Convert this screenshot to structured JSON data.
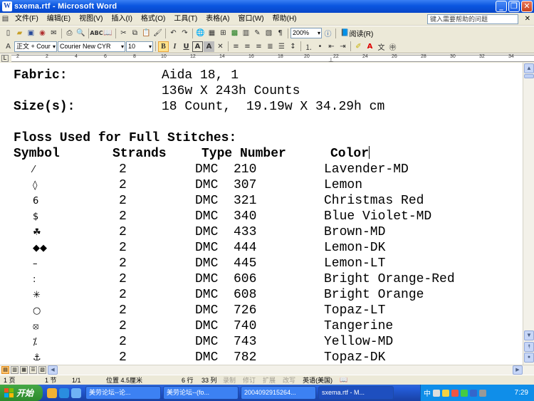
{
  "window": {
    "title": "sxema.rtf - Microsoft Word",
    "app_icon_letter": "W"
  },
  "menu": {
    "items": [
      "文件(F)",
      "编辑(E)",
      "视图(V)",
      "插入(I)",
      "格式(O)",
      "工具(T)",
      "表格(A)",
      "窗口(W)",
      "帮助(H)"
    ],
    "help_placeholder": "键入需要帮助的问题"
  },
  "toolbar": {
    "zoom": "200%",
    "reading_label": "阅读(R)",
    "style": "正文 + Cour",
    "font": "Courier New CYR",
    "size": "10",
    "bold": "B",
    "italic": "I",
    "underline": "U"
  },
  "ruler": {
    "numbers": [
      "2",
      "2",
      "4",
      "6",
      "8",
      "10",
      "12",
      "14",
      "16",
      "18",
      "20",
      "22",
      "24",
      "26",
      "28",
      "30",
      "32",
      "34"
    ]
  },
  "document": {
    "fabric_label": "Fabric:",
    "fabric_value": "Aida 18, 1",
    "counts": "136w X 243h Counts",
    "size_label": "Size(s):",
    "size_value": "18 Count,  19.19w X 34.29h cm",
    "floss_heading": "Floss Used for Full Stitches:",
    "headers": {
      "symbol": "Symbol",
      "strands": "Strands",
      "type_number": "Type Number",
      "color": "Color"
    },
    "rows": [
      {
        "symbol": "⁄",
        "strands": "2",
        "type": "DMC",
        "number": "210",
        "color": "Lavender-MD"
      },
      {
        "symbol": "◊",
        "strands": "2",
        "type": "DMC",
        "number": "307",
        "color": "Lemon"
      },
      {
        "symbol": "6",
        "strands": "2",
        "type": "DMC",
        "number": "321",
        "color": "Christmas Red"
      },
      {
        "symbol": "$",
        "strands": "2",
        "type": "DMC",
        "number": "340",
        "color": "Blue Violet-MD"
      },
      {
        "symbol": "☘",
        "strands": "2",
        "type": "DMC",
        "number": "433",
        "color": "Brown-MD"
      },
      {
        "symbol": "◆◆",
        "strands": "2",
        "type": "DMC",
        "number": "444",
        "color": "Lemon-DK"
      },
      {
        "symbol": "–",
        "strands": "2",
        "type": "DMC",
        "number": "445",
        "color": "Lemon-LT"
      },
      {
        "symbol": ":",
        "strands": "2",
        "type": "DMC",
        "number": "606",
        "color": "Bright Orange-Red"
      },
      {
        "symbol": "✳",
        "strands": "2",
        "type": "DMC",
        "number": "608",
        "color": "Bright Orange"
      },
      {
        "symbol": "○",
        "strands": "2",
        "type": "DMC",
        "number": "726",
        "color": "Topaz-LT"
      },
      {
        "symbol": "⦻",
        "strands": "2",
        "type": "DMC",
        "number": "740",
        "color": "Tangerine"
      },
      {
        "symbol": "⁒",
        "strands": "2",
        "type": "DMC",
        "number": "743",
        "color": "Yellow-MD"
      },
      {
        "symbol": "⚓",
        "strands": "2",
        "type": "DMC",
        "number": "782",
        "color": "Topaz-DK"
      }
    ]
  },
  "status": {
    "page": "1 页",
    "section": "1 节",
    "page_of": "1/1",
    "position": "位置 4.5厘米",
    "line": "6 行",
    "column": "33 列",
    "rec": "录制",
    "trk": "修订",
    "ext": "扩展",
    "ovr": "改写",
    "language": "英语(美国)"
  },
  "taskbar": {
    "start": "开始",
    "tasks": [
      "美劳论坛--论...",
      "美劳论坛--(fo...",
      "2004092915264...",
      "sxema.rtf - M..."
    ],
    "ime": "中",
    "clock": "7:29"
  }
}
